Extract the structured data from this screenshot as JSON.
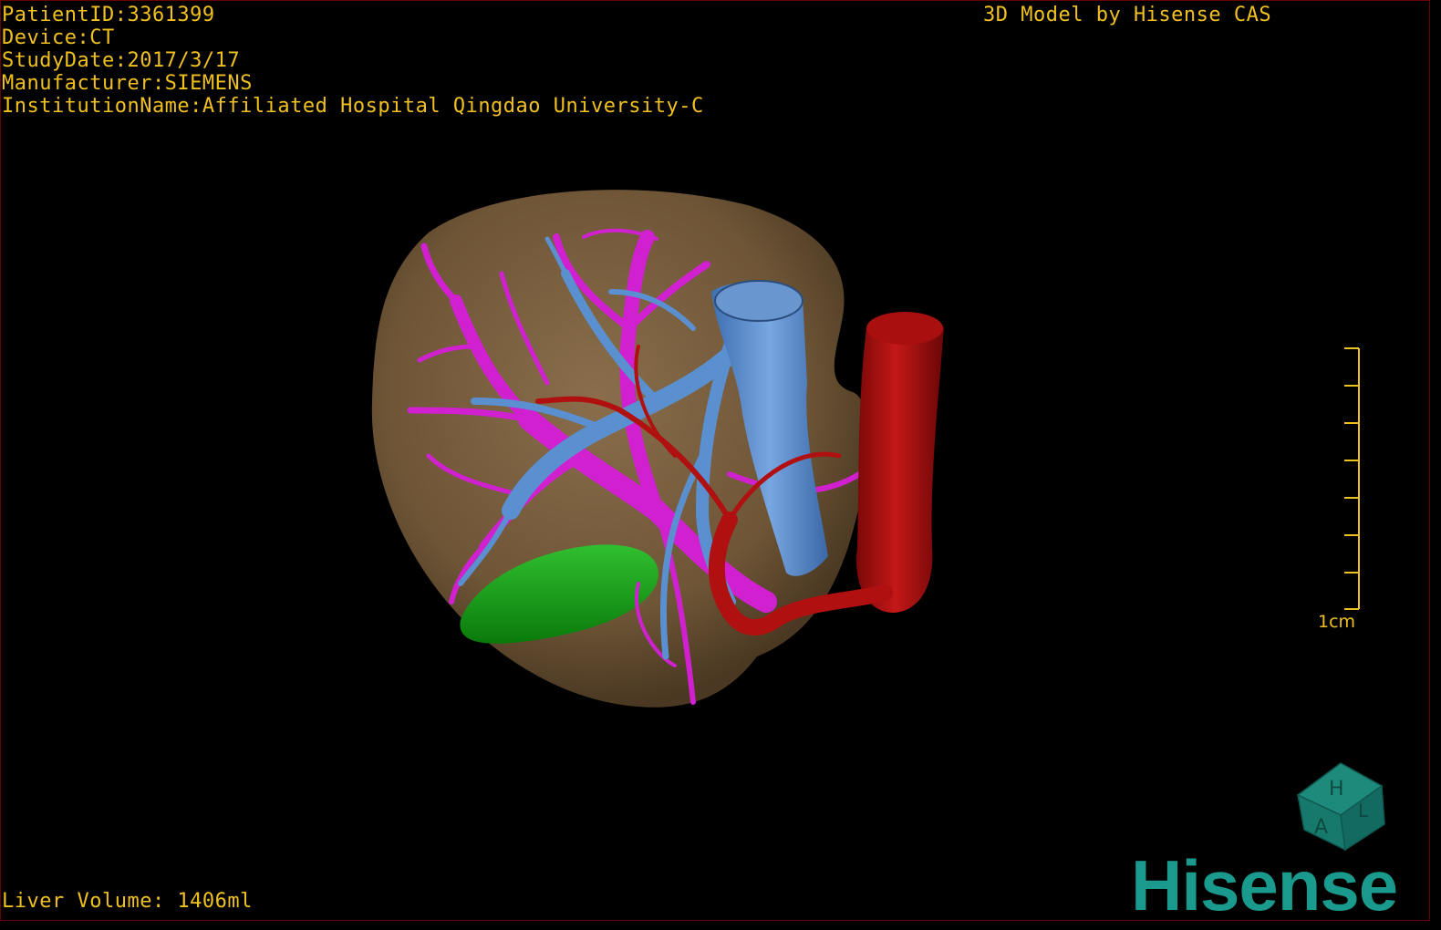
{
  "info": {
    "patient_id": "PatientID:3361399",
    "device": "Device:CT",
    "study_date": "StudyDate:2017/3/17",
    "manufacturer": "Manufacturer:SIEMENS",
    "institution": "InstitutionName:Affiliated Hospital Qingdao University-C"
  },
  "title": "3D Model by Hisense CAS",
  "volume": "Liver Volume: 1406ml",
  "ruler": {
    "label": "1cm"
  },
  "orientation_cube": {
    "face_top": "H",
    "face_front": "A",
    "face_side": "L"
  },
  "brand": "Hisense",
  "colors": {
    "overlay_text": "#f0c020",
    "liver": "#7a6040",
    "portal_vein": "#d020d0",
    "hepatic_vein": "#5a8fd0",
    "artery": "#b01010",
    "gallbladder": "#14a014",
    "brand": "#1a9a8c"
  }
}
